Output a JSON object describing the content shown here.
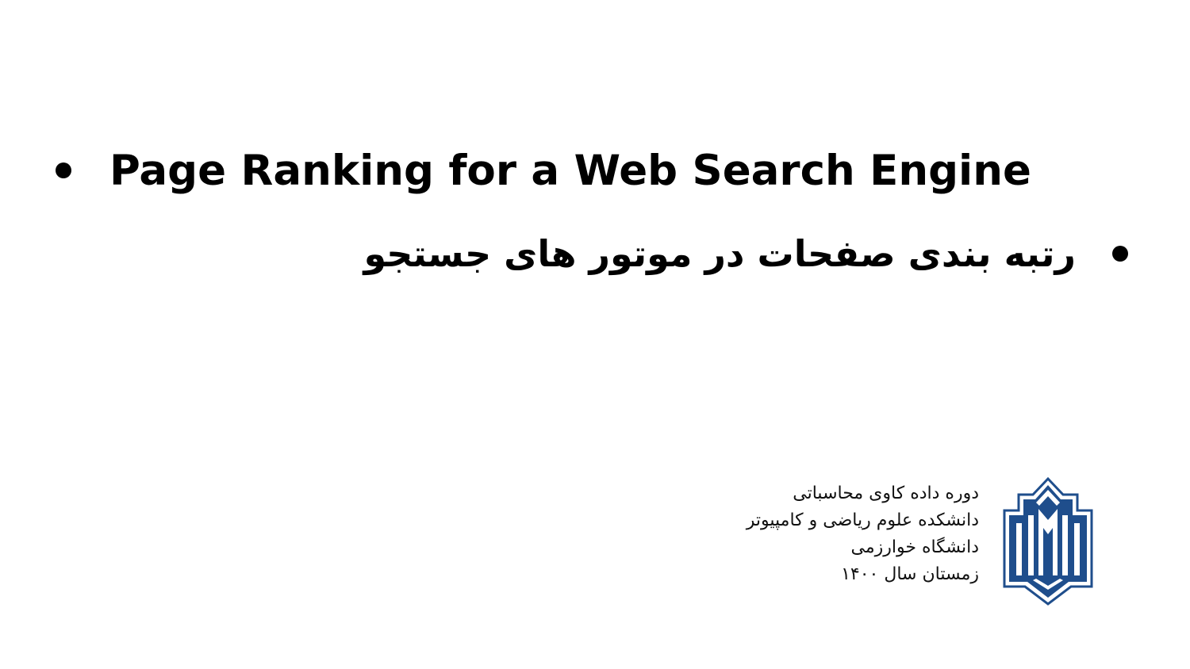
{
  "slide": {
    "bullets": [
      {
        "text": "Page Ranking for a Web Search Engine"
      },
      {
        "text": "رتبه بندی صفحات در موتور های جستجو"
      }
    ],
    "info_lines": [
      "دوره داده کاوی محاسباتی",
      "دانشکده علوم ریاضی و کامپیوتر",
      "دانشگاه خوارزمی",
      "زمستان سال ۱۴۰۰"
    ],
    "logo": {
      "icon": "university-emblem-icon",
      "color": "#1f4e8c"
    }
  }
}
